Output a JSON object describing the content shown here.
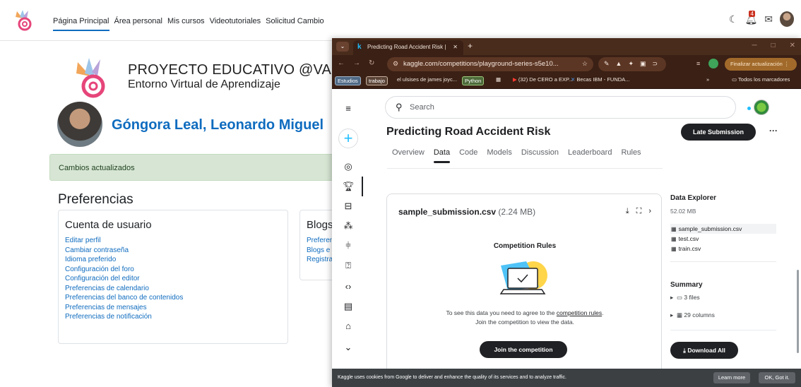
{
  "moodle": {
    "nav": [
      "Página Principal",
      "Área personal",
      "Mis cursos",
      "Videotutoriales",
      "Solicitud Cambio"
    ],
    "notifications_count": "4",
    "brand_title": "PROYECTO EDUCATIVO @VANZA",
    "brand_subtitle": "Entorno Virtual de Aprendizaje",
    "user_name": "Góngora Leal, Leonardo Miguel",
    "alert": "Cambios actualizados",
    "preferences_title": "Preferencias",
    "user_account": {
      "title": "Cuenta de usuario",
      "links": [
        "Editar perfil",
        "Cambiar contraseña",
        "Idioma preferido",
        "Configuración del foro",
        "Configuración del editor",
        "Preferencias de calendario",
        "Preferencias del banco de contenidos",
        "Preferencias de mensajes",
        "Preferencias de notificación"
      ]
    },
    "blogs": {
      "title": "Blogs",
      "links": [
        "Preferen",
        "Blogs e",
        "Registra"
      ]
    }
  },
  "browser": {
    "tab_title": "Predicting Road Accident Risk |",
    "url": "kaggle.com/competitions/playground-series-s5e10...",
    "update_button": "Finalizar actualización",
    "bookmarks": [
      "Estudios",
      "trabajo",
      "el ulsises de james joyc...",
      "Python",
      "(32) De CERO a EXP...",
      "Becas IBM - FUNDA...",
      "Todos los marcadores"
    ]
  },
  "kaggle": {
    "search_placeholder": "Search",
    "competition_title": "Predicting Road Accident Risk",
    "late_submission": "Late Submission",
    "tabs": [
      "Overview",
      "Data",
      "Code",
      "Models",
      "Discussion",
      "Leaderboard",
      "Rules"
    ],
    "active_tab": "Data",
    "file_name": "sample_submission.csv",
    "file_size": "(2.24 MB)",
    "rules_title": "Competition Rules",
    "rules_msg_prefix": "To see this data you need to agree to the",
    "rules_link": "competition rules",
    "rules_msg_suffix": ".",
    "rules_msg_line2": "Join the competition to view the data.",
    "join_button": "Join the competition",
    "data_explorer": {
      "title": "Data Explorer",
      "size": "52.02 MB",
      "files": [
        "sample_submission.csv",
        "test.csv",
        "train.csv"
      ]
    },
    "summary": {
      "title": "Summary",
      "files": "3 files",
      "columns": "29 columns"
    },
    "download_all": "Download All"
  },
  "cookie": {
    "text": "Kaggle uses cookies from Google to deliver and enhance the quality of its services and to analyze traffic.",
    "learn_more": "Learn more",
    "ok": "OK, Got it."
  }
}
